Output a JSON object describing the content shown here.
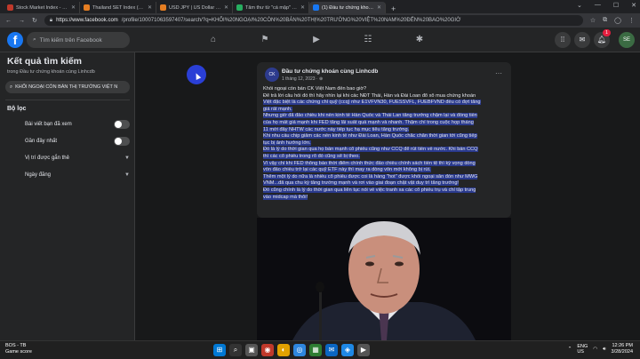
{
  "browser": {
    "tabs": [
      {
        "title": "Stock Market Index - Major Wo",
        "color": "#c0392b",
        "active": false
      },
      {
        "title": "Thailand SET Index (SETI) - Inve",
        "color": "#e67e22",
        "active": false
      },
      {
        "title": "USD JPY | US Dollar to Yen Live",
        "color": "#e67e22",
        "active": false
      },
      {
        "title": "Tâm thư từ \"cá mập\" Petri Deryn",
        "color": "#27ae60",
        "active": false
      },
      {
        "title": "(1) Đầu tư chứng khoán cùng Li",
        "color": "#1877f2",
        "active": true
      }
    ],
    "new_tab": "+",
    "window_controls": [
      "⌄",
      "—",
      "☐",
      "✕"
    ],
    "url_host": "https://www.facebook.com",
    "url_path": "/profile/100071063597407/search/?q=KHỐI%20NGOẠI%20CÒN%20BÁN%20THỊ%20TRƯỜNG%20VIỆT%20NAM%20ĐẾN%20BAO%20GIỜ"
  },
  "facebook": {
    "logo": "f",
    "search_placeholder": "Tìm kiếm trên Facebook",
    "notification_count": "1",
    "avatar_initials": "SE"
  },
  "sidebar": {
    "title": "Kết quả tìm kiếm",
    "subtitle": "trong Đầu tư chứng khoán cùng Linhcdb",
    "query": "KHỐI NGOẠI CÒN BÁN THỊ TRƯỜNG VIỆT N",
    "filters_heading": "Bộ lọc",
    "filters": [
      {
        "label": "Bài viết bạn đã xem",
        "control": "toggle"
      },
      {
        "label": "Gần đây nhất",
        "control": "toggle"
      },
      {
        "label": "Vị trí được gắn thẻ",
        "control": "dropdown"
      },
      {
        "label": "Ngày đăng",
        "control": "dropdown"
      }
    ]
  },
  "post": {
    "author": "Đầu tư chứng khoán cùng Linhcdb",
    "date": "1 tháng 12, 2023 · ⊕",
    "more": "···",
    "lines": [
      {
        "text": "Khối ngoại còn bán CK Việt Nam đến bao giờ?",
        "hl": false
      },
      {
        "text": "Để trả lời câu hỏi đó thì hãy nhìn lại khi các NĐT Thái, Hàn và Đài Loan đổ xô mua chứng khoán",
        "hl": false
      },
      {
        "text": "Việt đặc biệt là các chứng chỉ quỹ (ccq) như  E1VFVN30,  FUESSVFL, FUEBFVND đều có đợt tăng",
        "hl": true
      },
      {
        "text": "giá rất mạnh.",
        "hl": true
      },
      {
        "text": "Nhưng giờ đã đảo chiều khi nền kinh tế Hàn Quốc và Thái Lan tăng trưởng chậm lại và đồng tiền",
        "hl": true
      },
      {
        "text": "của họ mất giá mạnh khi FED tăng lãi suất quá mạnh và nhanh. Thậm chí trong cuộc họp tháng",
        "hl": true
      },
      {
        "text": "11 mới đây NHTW các nước này tiếp tục hạ mục tiêu tăng trưởng.",
        "hl": true
      },
      {
        "text": "Khi nhu cầu chip giảm các nền kinh tế như Đài Loan, Hàn Quốc chắc chắn thời gian tới cũng tiếp",
        "hl": true
      },
      {
        "text": "tục bị ảnh hưởng lớn.",
        "hl": true
      },
      {
        "text": "Đó là lý do thời gian qua họ bán mạnh cổ phiếu cũng như CCQ để rút tiền về nước. Khi bán CCQ",
        "hl": true
      },
      {
        "text": "thì các cổ phiếu trong rổ đó cũng sẽ bị theo.",
        "hl": true
      },
      {
        "text": "Vì vậy chỉ khi FED thông báo thời điểm chính thức đảo chiều chính sách tiền tệ thì kỳ vọng dòng",
        "hl": true
      },
      {
        "text": "vốn đảo chiều trở lại các quỹ ETF này thì may ra dòng vốn mới không bị rút.",
        "hl": true
      },
      {
        "text": "Thêm một lý do nữa là nhiều cổ phiếu được coi là hàng \"hot\" được khối ngoại săn đón như MWG",
        "hl": true
      },
      {
        "text": "VNM...đã qua chu kỳ tăng trưởng mạnh và rơi vào giai đoạn chật vật duy trì tăng trưởng!",
        "hl": true
      },
      {
        "text": "Đó cũng chính là lý do thời gian qua liên tục nói về việc tranh xa các cổ phiếu trụ và chỉ tập trung",
        "hl": true
      },
      {
        "text": "vào midcap mà thôi!",
        "hl": true
      }
    ]
  },
  "taskbar": {
    "weather_temp": "BOS - TB",
    "weather_sub": "Game score",
    "apps": [
      {
        "icon": "⊞",
        "color": "#0078d4"
      },
      {
        "icon": "⌕",
        "color": "#333"
      },
      {
        "icon": "▣",
        "color": "#555"
      },
      {
        "icon": "◉",
        "color": "#c0392b"
      },
      {
        "icon": "◐",
        "color": "#e1a100"
      },
      {
        "icon": "◎",
        "color": "#2e86de"
      },
      {
        "icon": "▦",
        "color": "#2e7d32"
      },
      {
        "icon": "✉",
        "color": "#0a66c2"
      },
      {
        "icon": "◈",
        "color": "#1e88e5"
      },
      {
        "icon": "▶",
        "color": "#555"
      }
    ],
    "lang": "ENG\nUS",
    "time": "12:26 PM",
    "date": "3/28/2024"
  }
}
